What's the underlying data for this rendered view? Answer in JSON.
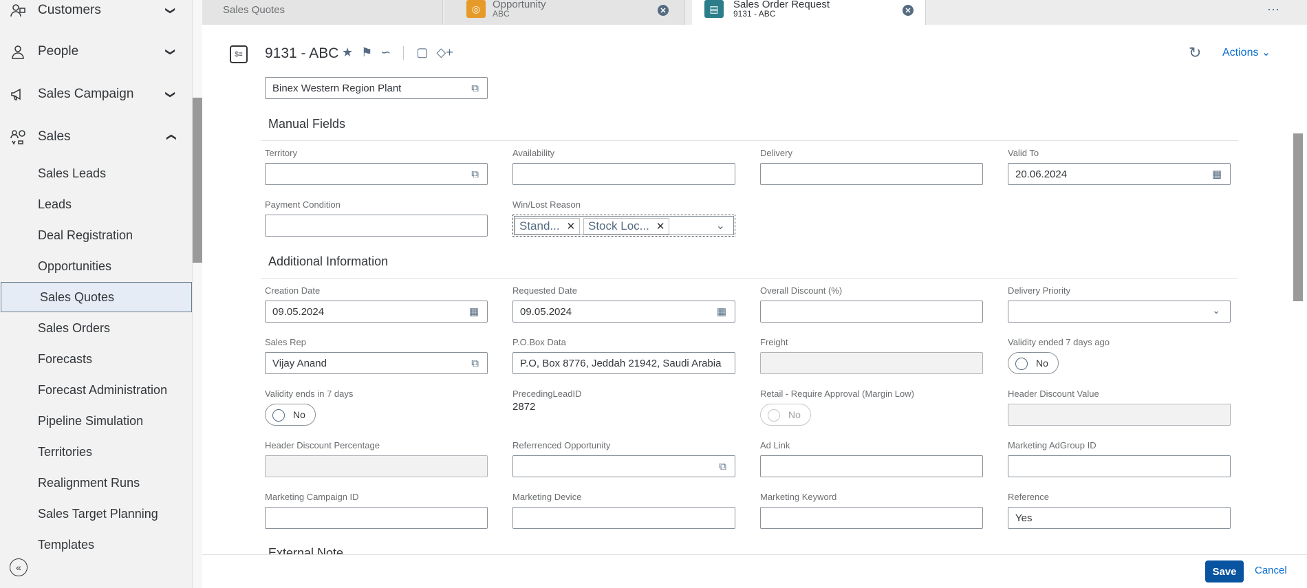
{
  "sidebar": {
    "groups": [
      {
        "label": "Customers",
        "icon": "customers-icon",
        "chevron": "chevron-down"
      },
      {
        "label": "People",
        "icon": "person-icon",
        "chevron": "chevron-down"
      },
      {
        "label": "Sales Campaign",
        "icon": "megaphone-icon",
        "chevron": "chevron-down"
      },
      {
        "label": "Sales",
        "icon": "sales-icon",
        "chevron": "chevron-up"
      }
    ],
    "items": [
      "Sales Leads",
      "Leads",
      "Deal Registration",
      "Opportunities",
      "Sales Quotes",
      "Sales Orders",
      "Forecasts",
      "Forecast Administration",
      "Pipeline Simulation",
      "Territories",
      "Realignment Runs",
      "Sales Target Planning",
      "Templates"
    ],
    "active_item": "Sales Quotes"
  },
  "tabs": [
    {
      "title": "Sales Quotes"
    },
    {
      "title": "Opportunity",
      "sub": "ABC"
    },
    {
      "title": "Sales Order Request",
      "sub": "9131 - ABC",
      "active": true
    }
  ],
  "header": {
    "title": "9131 - ABC",
    "actions_label": "Actions"
  },
  "top_field": {
    "value": "Binex Western Region Plant"
  },
  "sections": {
    "manual": "Manual Fields",
    "additional": "Additional Information",
    "external": "External Note"
  },
  "manual": {
    "territory": {
      "label": "Territory",
      "value": ""
    },
    "availability": {
      "label": "Availability",
      "value": ""
    },
    "delivery": {
      "label": "Delivery",
      "value": ""
    },
    "valid_to": {
      "label": "Valid To",
      "value": "20.06.2024"
    },
    "payment": {
      "label": "Payment Condition",
      "value": ""
    },
    "winlost": {
      "label": "Win/Lost Reason",
      "tokens": [
        "Stand...",
        "Stock Loc..."
      ]
    }
  },
  "additional": {
    "creation_date": {
      "label": "Creation Date",
      "value": "09.05.2024"
    },
    "requested_date": {
      "label": "Requested Date",
      "value": "09.05.2024"
    },
    "overall_discount": {
      "label": "Overall Discount (%)",
      "value": ""
    },
    "delivery_priority": {
      "label": "Delivery Priority",
      "value": ""
    },
    "sales_rep": {
      "label": "Sales Rep",
      "value": "Vijay Anand"
    },
    "pobox": {
      "label": "P.O.Box Data",
      "value": "P.O, Box 8776, Jeddah 21942, Saudi Arabia"
    },
    "freight": {
      "label": "Freight",
      "value": ""
    },
    "validity_ended": {
      "label": "Validity ended 7 days ago",
      "value": "No"
    },
    "validity_ends": {
      "label": "Validity ends in 7 days",
      "value": "No"
    },
    "preceding_lead": {
      "label": "PrecedingLeadID",
      "value": "2872"
    },
    "retail_approval": {
      "label": "Retail - Require Approval (Margin Low)",
      "value": "No"
    },
    "header_discount_value": {
      "label": "Header Discount Value",
      "value": ""
    },
    "header_discount_pct": {
      "label": "Header Discount Percentage",
      "value": ""
    },
    "ref_opportunity": {
      "label": "Referrenced Opportunity",
      "value": ""
    },
    "ad_link": {
      "label": "Ad Link",
      "value": ""
    },
    "adgroup": {
      "label": "Marketing AdGroup ID",
      "value": ""
    },
    "campaign": {
      "label": "Marketing Campaign ID",
      "value": ""
    },
    "device": {
      "label": "Marketing Device",
      "value": ""
    },
    "keyword": {
      "label": "Marketing Keyword",
      "value": ""
    },
    "reference": {
      "label": "Reference",
      "value": "Yes"
    }
  },
  "footer": {
    "save": "Save",
    "cancel": "Cancel"
  },
  "colors": {
    "accent": "#0a6ed1",
    "save_bg": "#0854a0",
    "active_nav": "#e5ecf5"
  }
}
